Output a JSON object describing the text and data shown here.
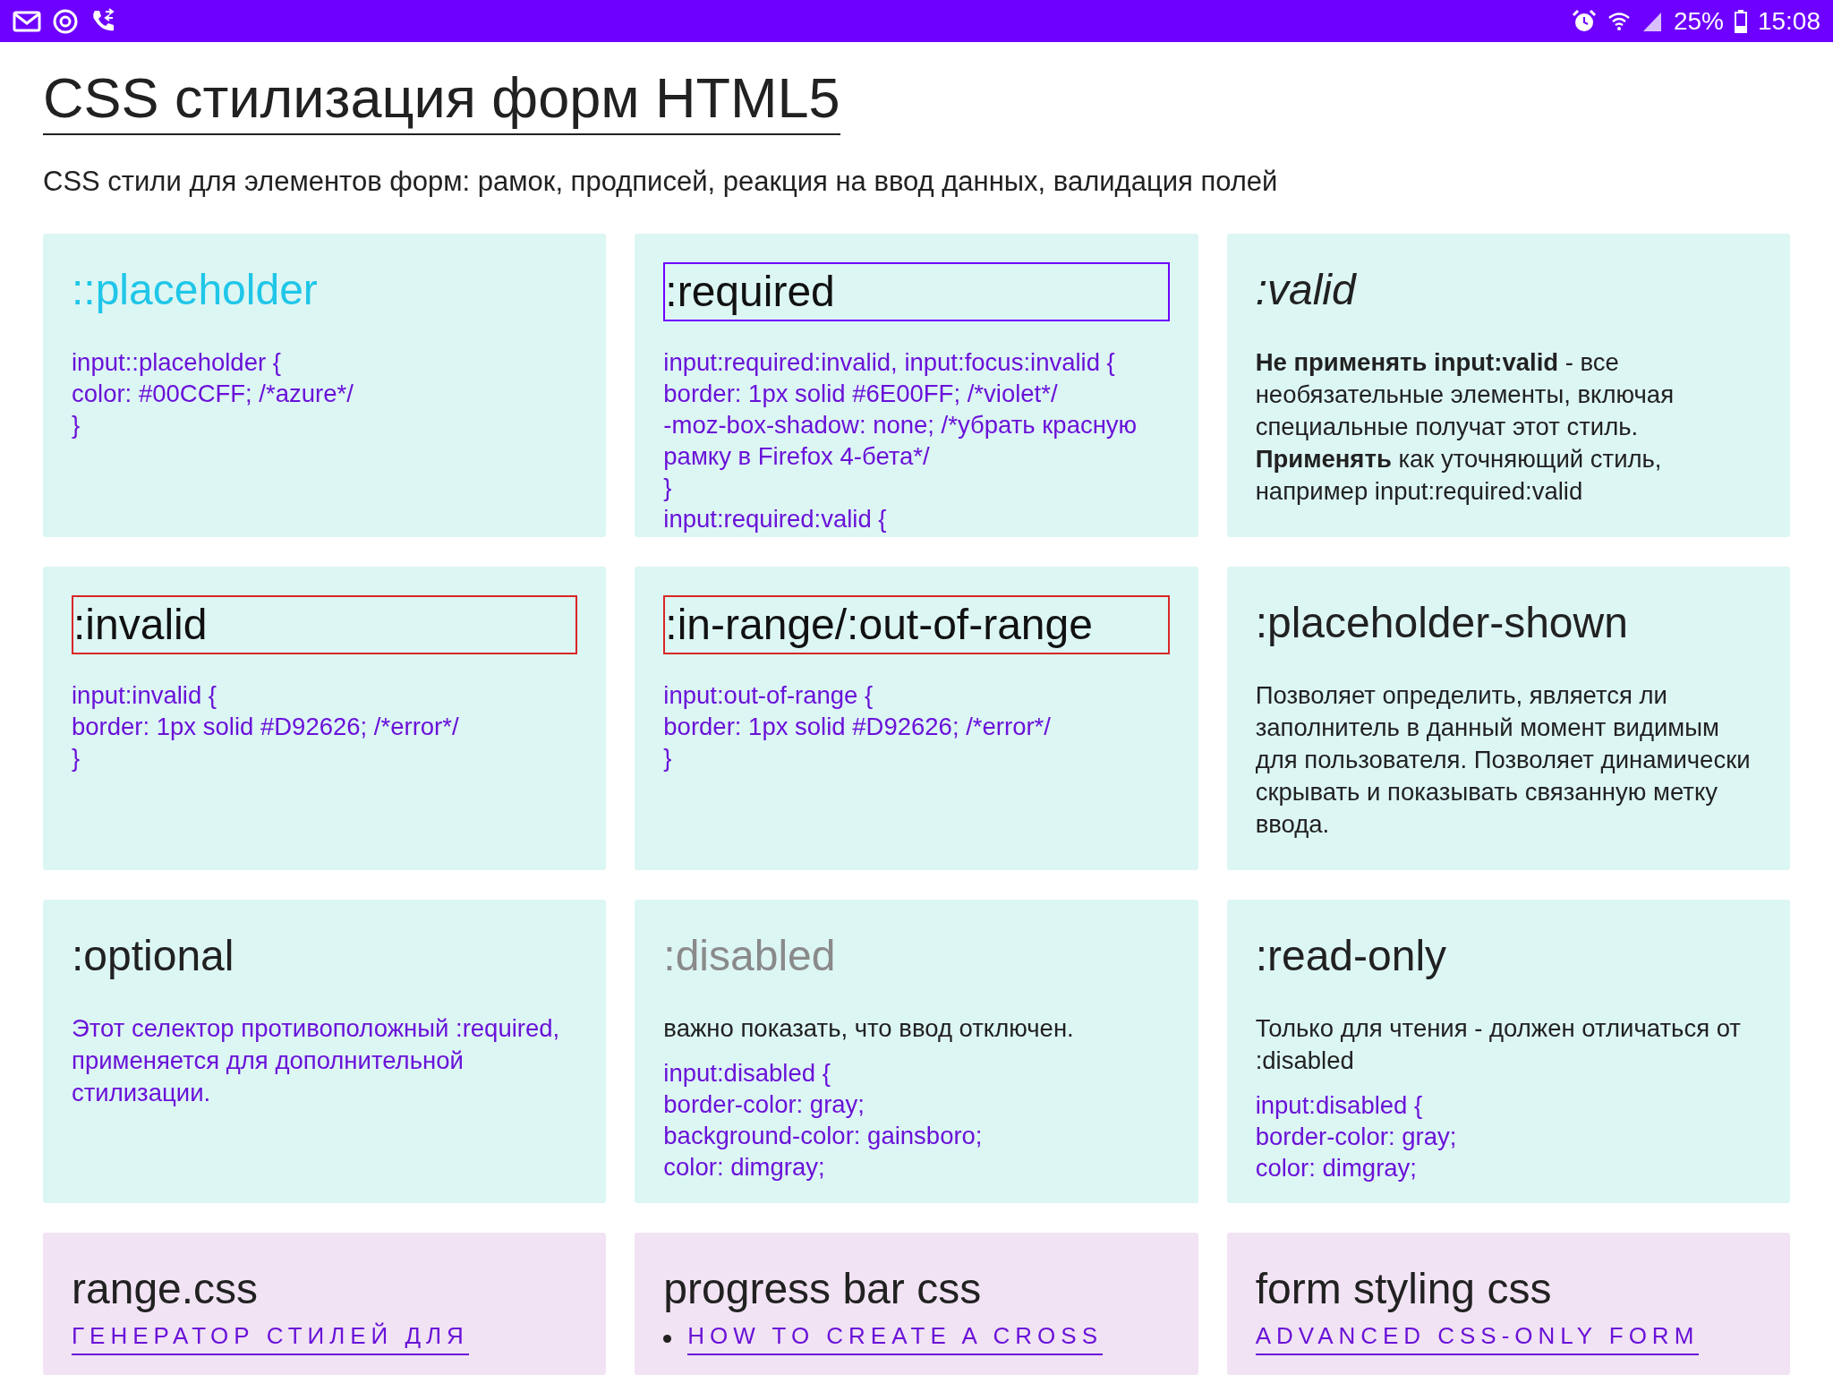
{
  "status_bar": {
    "battery": "25%",
    "time": "15:08"
  },
  "page": {
    "title": "CSS стилизация форм HTML5",
    "subtitle": "CSS стили для элементов форм: рамок, продписей, реакция на ввод данных, валидация полей"
  },
  "cards": [
    {
      "kind": "tip",
      "heading": {
        "text": "::placeholder",
        "kind": "azure"
      },
      "blocks": [
        {
          "kind": "code",
          "lines": [
            "input::placeholder {",
            "color: #00CCFF; /*azure*/",
            "}"
          ]
        }
      ]
    },
    {
      "kind": "tip",
      "heading": {
        "text": ":required",
        "kind": "boxed_violet"
      },
      "blocks": [
        {
          "kind": "code",
          "lines": [
            "input:required:invalid, input:focus:invalid {",
            "border: 1px solid #6E00FF; /*violet*/",
            "-moz-box-shadow: none; /*убрать красную",
            "рамку в Firefox 4-бета*/",
            "}",
            "input:required:valid {"
          ]
        }
      ]
    },
    {
      "kind": "tip",
      "heading": {
        "text": ":valid",
        "kind": "italic"
      },
      "blocks": [
        {
          "kind": "text",
          "text": "**Не применять input:valid** - все необязательные элементы, включая специальные получат этот стиль. **Применять** как уточняющий стиль, например input:required:valid"
        }
      ]
    },
    {
      "kind": "tip",
      "heading": {
        "text": ":invalid",
        "kind": "boxed_red"
      },
      "blocks": [
        {
          "kind": "code",
          "lines": [
            "input:invalid {",
            "border: 1px solid #D92626; /*error*/",
            "}"
          ]
        }
      ]
    },
    {
      "kind": "tip",
      "heading": {
        "text": ":in-range/:out-of-range",
        "kind": "boxed_red"
      },
      "blocks": [
        {
          "kind": "code",
          "lines": [
            "input:out-of-range {",
            "border: 1px solid #D92626; /*error*/",
            "}"
          ]
        }
      ]
    },
    {
      "kind": "tip",
      "heading": {
        "text": ":placeholder-shown",
        "kind": "normal"
      },
      "blocks": [
        {
          "kind": "text",
          "text": "Позволяет определить, является ли заполнитель в данный момент видимым для пользователя. Позволяет динамически скрывать и показывать связанную метку ввода."
        }
      ]
    },
    {
      "kind": "tip",
      "heading": {
        "text": ":optional",
        "kind": "normal"
      },
      "blocks": [
        {
          "kind": "violet_text",
          "text": "Этот селектор противоположный :required, применяется для дополнительной стилизации."
        }
      ]
    },
    {
      "kind": "tip",
      "heading": {
        "text": ":disabled",
        "kind": "disabled"
      },
      "blocks": [
        {
          "kind": "text",
          "text": "важно показать, что ввод отключен."
        },
        {
          "kind": "code",
          "lines": [
            "input:disabled {",
            "border-color: gray;",
            "background-color: gainsboro;",
            "color: dimgray;"
          ]
        }
      ]
    },
    {
      "kind": "tip",
      "heading": {
        "text": ":read-only",
        "kind": "normal"
      },
      "blocks": [
        {
          "kind": "text",
          "text": "Только для чтения - должен отличаться от :disabled"
        },
        {
          "kind": "code",
          "lines": [
            "input:disabled {",
            "border-color: gray;",
            "color: dimgray;"
          ]
        }
      ]
    },
    {
      "kind": "links",
      "heading": {
        "text": "range.css",
        "kind": "normal"
      },
      "blocks": [
        {
          "kind": "link",
          "text": "ГЕНЕРАТОР СТИЛЕЙ ДЛЯ"
        }
      ]
    },
    {
      "kind": "links",
      "heading": {
        "text": "progress bar css",
        "kind": "normal"
      },
      "blocks": [
        {
          "kind": "bullet_link",
          "text": "HOW TO CREATE A CROSS"
        }
      ]
    },
    {
      "kind": "links",
      "heading": {
        "text": "form styling css",
        "kind": "normal"
      },
      "blocks": [
        {
          "kind": "link",
          "text": "ADVANCED CSS-ONLY FORM"
        }
      ]
    }
  ]
}
